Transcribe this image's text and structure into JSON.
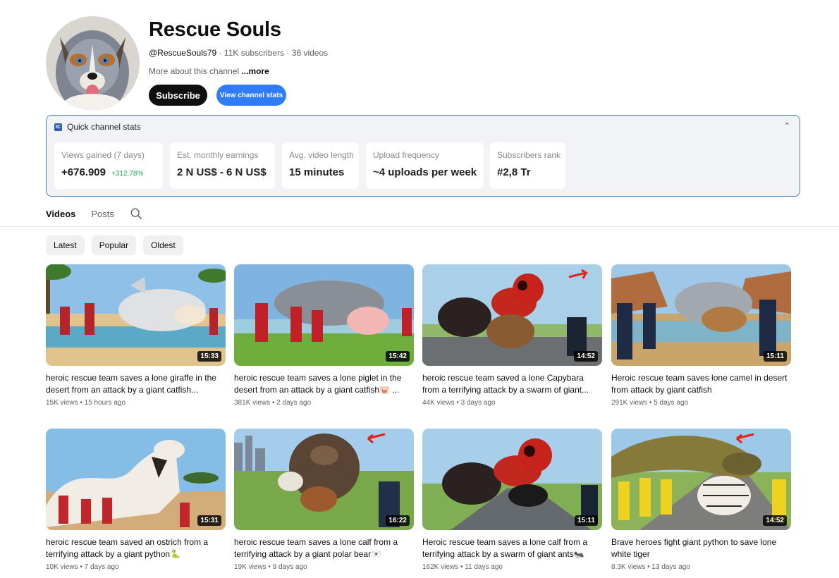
{
  "channel": {
    "name": "Rescue Souls",
    "handle": "@RescueSouls79",
    "subscribers": "11K subscribers",
    "videos_count": "36 videos",
    "about": "More about this channel",
    "more_label": "...more",
    "subscribe_label": "Subscribe",
    "stats_button_label": "View channel stats"
  },
  "stats": {
    "title": "Quick channel stats",
    "logo_text": "IC",
    "caret": "⌃",
    "cards": [
      {
        "label": "Views gained (7 days)",
        "value": "+676.909",
        "delta": "+312,78%"
      },
      {
        "label": "Est. monthly earnings",
        "value": "2 N US$ - 6 N US$"
      },
      {
        "label": "Avg. video length",
        "value": "15 minutes"
      },
      {
        "label": "Upload frequency",
        "value": "~4 uploads per week"
      },
      {
        "label": "Subscribers rank",
        "value": "#2,8 Tr"
      }
    ]
  },
  "tabs": [
    "Videos",
    "Posts"
  ],
  "chips": [
    "Latest",
    "Popular",
    "Oldest"
  ],
  "videos": [
    {
      "title": "heroic rescue team saves a lone giraffe in the desert from an attack by a giant catfish...",
      "views": "15K views",
      "age": "15 hours ago",
      "duration": "15:33"
    },
    {
      "title": "heroic rescue team saves a lone piglet in the desert from an attack by a giant catfish🐷 ...",
      "views": "381K views",
      "age": "2 days ago",
      "duration": "15:42"
    },
    {
      "title": "heroic rescue team saved a lone Capybara from a terrifying attack by a swarm of giant...",
      "views": "44K views",
      "age": "3 days ago",
      "duration": "14:52"
    },
    {
      "title": "Heroic rescue team saves lone camel in desert from attack by giant catfish",
      "views": "291K views",
      "age": "5 days ago",
      "duration": "15:11"
    },
    {
      "title": "heroic rescue team saved an ostrich from a terrifying attack by a giant python🐍",
      "views": "10K views",
      "age": "7 days ago",
      "duration": "15:31"
    },
    {
      "title": "heroic rescue team saves a lone calf from a terrifying attack by a giant polar bear🐻‍❄️",
      "views": "19K views",
      "age": "9 days ago",
      "duration": "16:22"
    },
    {
      "title": "Heroic rescue team saves a lone calf from a terrifying attack by a swarm of giant ants🐜",
      "views": "162K views",
      "age": "11 days ago",
      "duration": "15:11"
    },
    {
      "title": "Brave heroes fight giant python to save lone white tiger",
      "views": "8.3K views",
      "age": "13 days ago",
      "duration": "14:52"
    }
  ]
}
